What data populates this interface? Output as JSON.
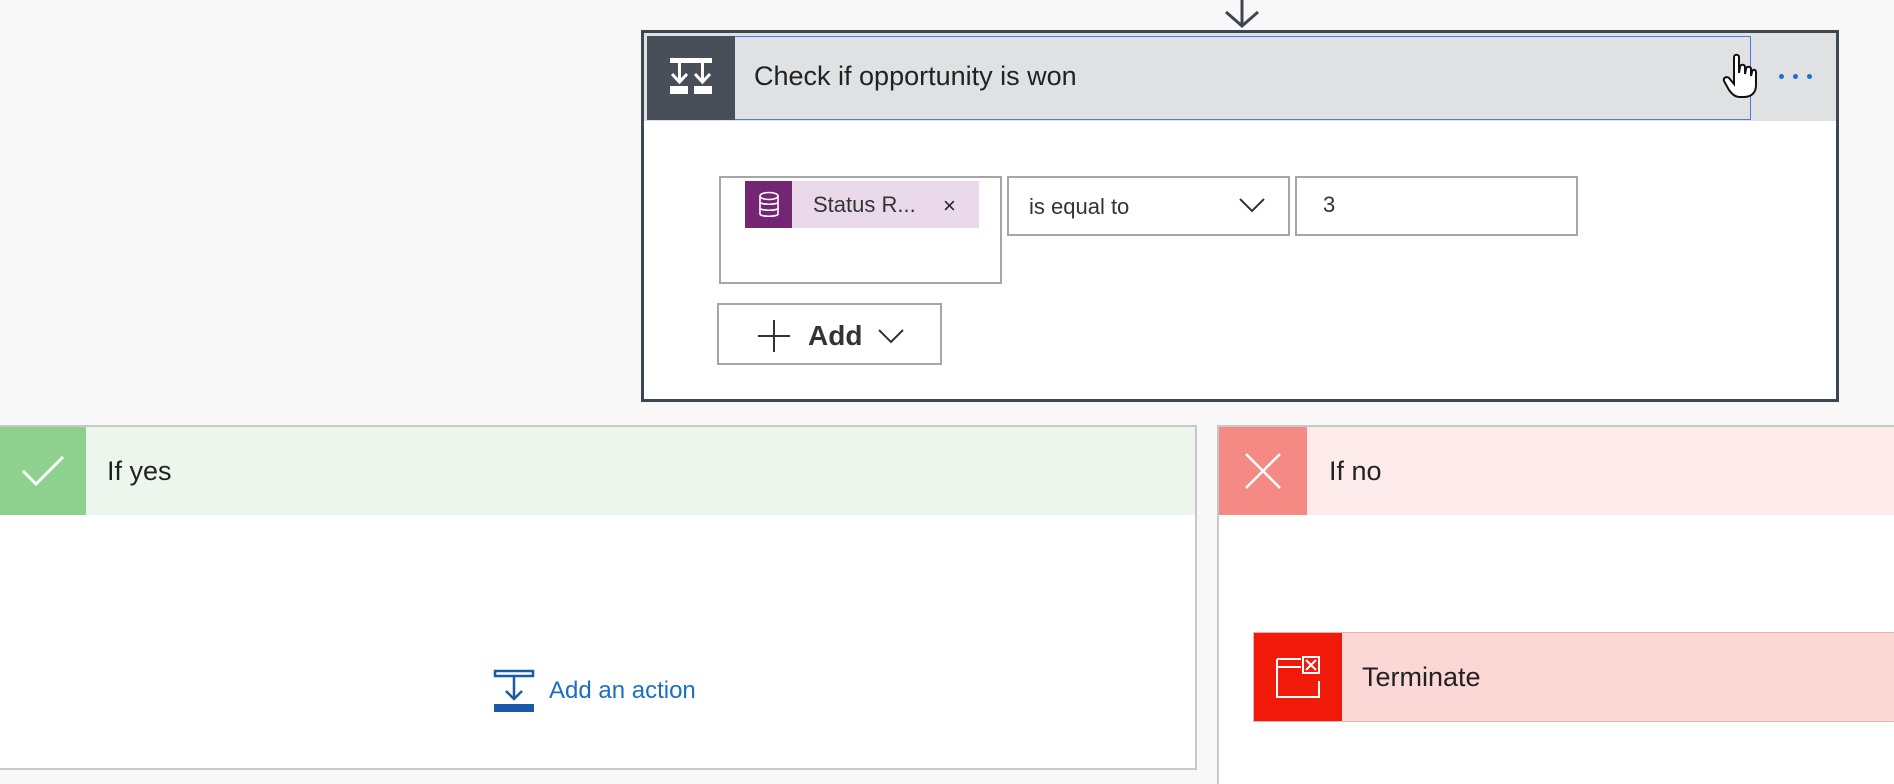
{
  "condition": {
    "title": "Check if opportunity is won",
    "operand_token": "Status R...",
    "token_remove_label": "×",
    "operator": "is equal to",
    "value": "3",
    "add_label": "Add",
    "icons": {
      "header": "condition-icon",
      "token": "database-icon",
      "more": "more-options-icon"
    }
  },
  "branches": {
    "yes": {
      "title": "If yes",
      "add_action_label": "Add an action",
      "icon": "checkmark-icon",
      "color": "#8ed18e"
    },
    "no": {
      "title": "If no",
      "icon": "close-icon",
      "color": "#f58a84",
      "action": {
        "title": "Terminate",
        "icon": "terminate-icon",
        "color": "#f11a0a"
      }
    }
  },
  "colors": {
    "accent": "#1a6fc4",
    "condition_header": "#484f58",
    "token": "#742574"
  }
}
